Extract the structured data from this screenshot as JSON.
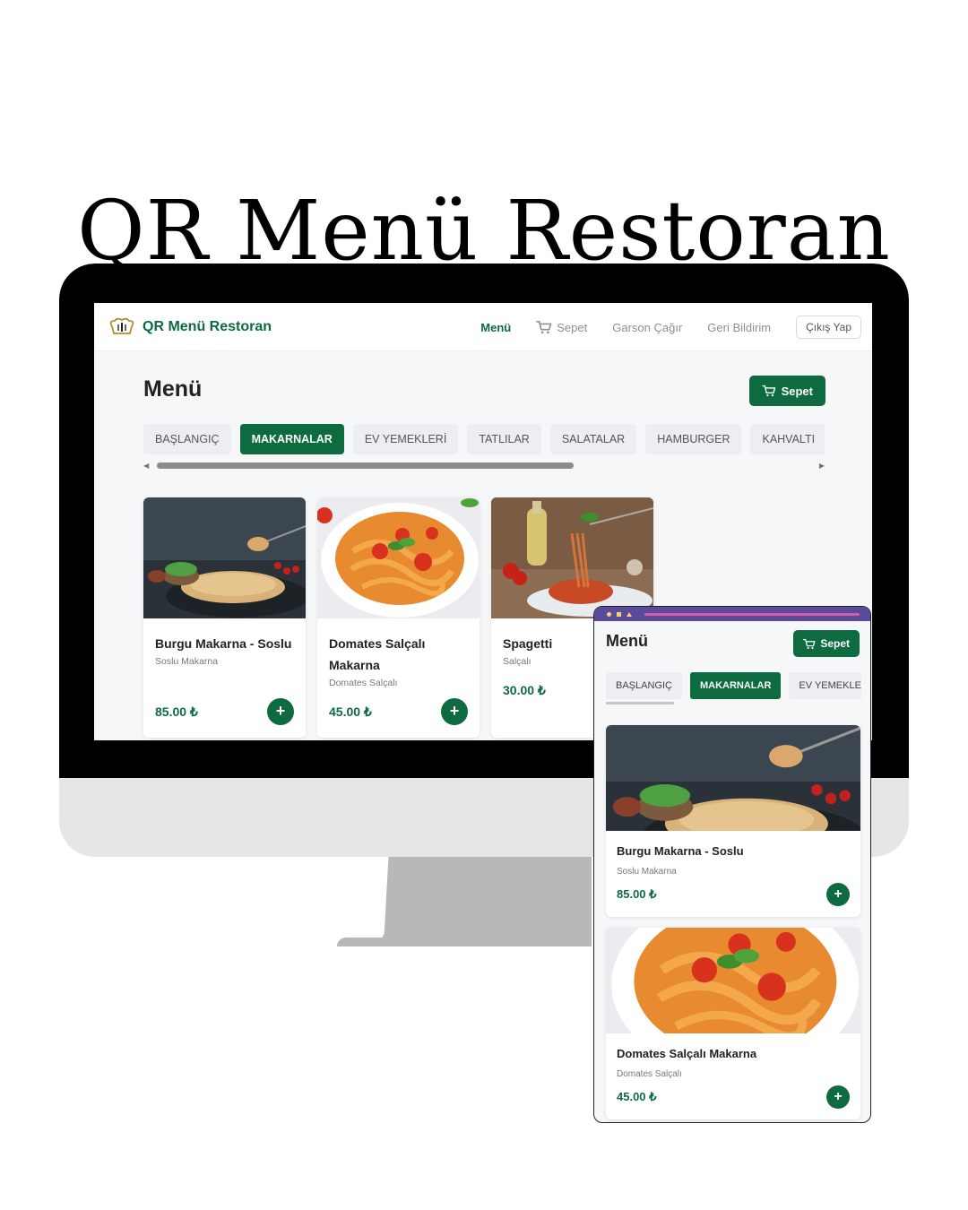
{
  "headline": "QR Menü Restoran",
  "colors": {
    "brand_green": "#0d6b3f",
    "price_green": "#0d6b3f",
    "phone_bar": "#5a4a9c"
  },
  "desktop": {
    "brand_name": "QR Menü Restoran",
    "brand_icon": "chef-hat-icon",
    "nav": {
      "menu": "Menü",
      "cart": "Sepet",
      "call_waiter": "Garson Çağır",
      "feedback": "Geri Bildirim",
      "logout": "Çıkış Yap"
    },
    "title": "Menü",
    "cart_button": "Sepet",
    "categories": [
      "BAŞLANGIÇ",
      "MAKARNALAR",
      "EV YEMEKLERİ",
      "TATLILAR",
      "SALATALAR",
      "HAMBURGER",
      "KAHVALTI"
    ],
    "active_category": "MAKARNALAR",
    "products": [
      {
        "name": "Burgu Makarna - Soslu",
        "desc": "Soslu Makarna",
        "price": "85.00 ₺"
      },
      {
        "name": "Domates Salçalı Makarna",
        "desc": "Domates Salçalı",
        "price": "45.00 ₺"
      },
      {
        "name": "Spagetti",
        "desc": "Salçalı",
        "price": "30.00 ₺"
      }
    ]
  },
  "mobile": {
    "title": "Menü",
    "cart_button": "Sepet",
    "categories": [
      "BAŞLANGIÇ",
      "MAKARNALAR",
      "EV YEMEKLERİ"
    ],
    "products": [
      {
        "name": "Burgu Makarna - Soslu",
        "desc": "Soslu Makarna",
        "price": "85.00 ₺"
      },
      {
        "name": "Domates Salçalı Makarna",
        "desc": "Domates Salçalı",
        "price": "45.00 ₺"
      }
    ]
  }
}
